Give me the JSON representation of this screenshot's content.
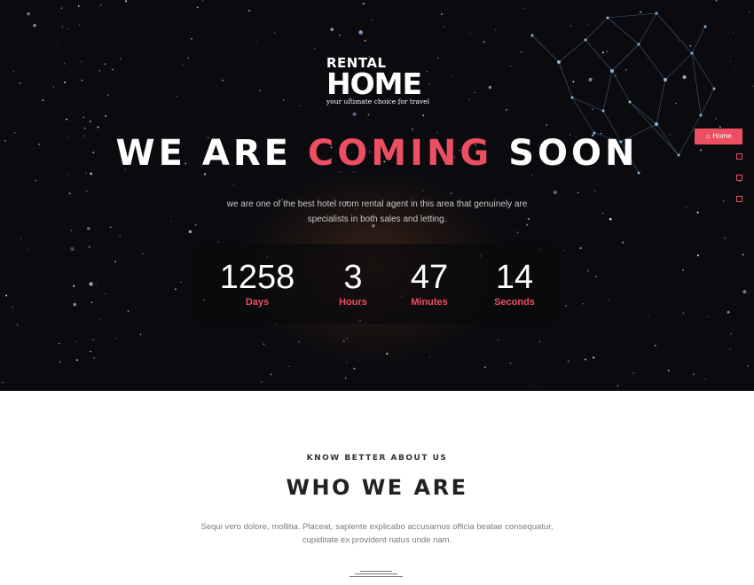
{
  "logo": {
    "line1": "RENTAL",
    "line2": "HOME",
    "tagline": "your ultimate choice for travel"
  },
  "hero": {
    "headline_part1": "WE ARE ",
    "headline_accent": "COMING",
    "headline_part2": " SOON",
    "description": "we are one of the best hotel room rental agent in this area that genuinely are specialists in both sales and letting."
  },
  "countdown": [
    {
      "value": "1258",
      "label": "Days"
    },
    {
      "value": "3",
      "label": "Hours"
    },
    {
      "value": "47",
      "label": "Minutes"
    },
    {
      "value": "14",
      "label": "Seconds"
    }
  ],
  "side_nav": {
    "home_label": "Home",
    "home_icon": "home-icon",
    "dots": 3
  },
  "about": {
    "kicker": "KNOW BETTER ABOUT US",
    "title": "WHO WE ARE",
    "description": "Sequi vero dolore, mollitia. Placeat, sapiente explicabo accusamus officia beatae consequatur, cupiditate ex provident natus unde nam."
  },
  "colors": {
    "accent": "#ec4e62",
    "hero_bg": "#08080c",
    "text_light": "#ffffff"
  }
}
